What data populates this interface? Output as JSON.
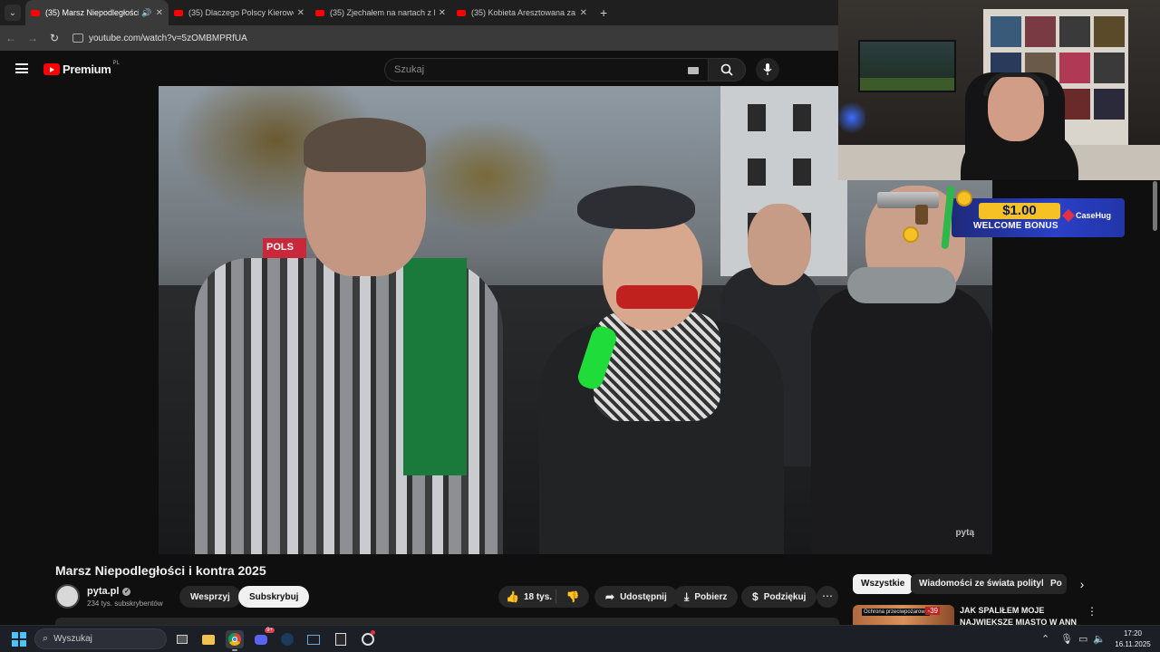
{
  "browser": {
    "tabs": [
      {
        "title": "(35) Marsz Niepodległości i",
        "active": true
      },
      {
        "title": "(35) Dlaczego Polscy Kierowcy I",
        "active": false
      },
      {
        "title": "(35) Zjechałem na nartach z Mo",
        "active": false
      },
      {
        "title": "(35) Kobieta Aresztowana za Uj",
        "active": false
      }
    ],
    "url": "youtube.com/watch?v=5zOMBMPRfUA"
  },
  "youtube": {
    "logo_text": "Premium",
    "logo_region": "PL",
    "search_placeholder": "Szukaj"
  },
  "video": {
    "overlay_sign": "POLS",
    "watermark": "pytą",
    "title": "Marsz Niepodległości i kontra 2025"
  },
  "ad": {
    "amount": "$1.00",
    "text": "WELCOME BONUS",
    "brand": "CaseHug"
  },
  "channel": {
    "name": "pyta.pl",
    "subscribers": "234 tys. subskrybentów",
    "support_label": "Wesprzyj",
    "subscribe_label": "Subskrybuj"
  },
  "actions": {
    "likes": "18 tys.",
    "share": "Udostępnij",
    "download": "Pobierz",
    "thanks": "Podziękuj"
  },
  "chips": [
    "Wszystkie",
    "Wiadomości ze świata polityki",
    "Po"
  ],
  "suggestion": {
    "title": "JAK SPALIŁEM MOJE NAJWIĘKSZE MIASTO W ANN",
    "tag": "Ochrona przeciwpożarowa",
    "badge": "-39"
  },
  "taskbar": {
    "search_label": "Wyszukaj",
    "time": "17:20",
    "date": "16.11.2025",
    "discord_badge": "9+"
  },
  "colors": {
    "yt_red": "#ff0000",
    "win_blue": "#4cc2ff",
    "ad_gold": "#f5c125",
    "mic_green": "#1fdc3a"
  }
}
